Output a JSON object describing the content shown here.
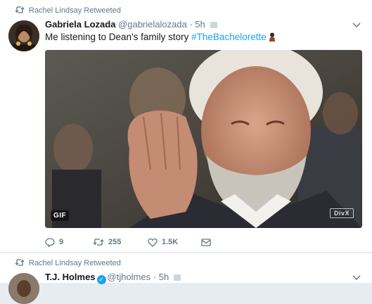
{
  "colors": {
    "accent": "#1da1f2",
    "secondary_text": "#657786",
    "primary_text": "#14171a",
    "background": "#e6ecf0"
  },
  "tweet1": {
    "retweet_label": "Rachel Lindsay Retweeted",
    "author_name": "Gabriela Lozada",
    "handle": "@gabrielalozada",
    "dot": "·",
    "time": "5h",
    "text_prefix": "Me listening to Dean's family story ",
    "hashtag": "#TheBachelorette",
    "media": {
      "gif_label": "GIF",
      "watermark": "DivX"
    },
    "actions": {
      "replies": "9",
      "retweets": "255",
      "likes": "1.5K"
    },
    "icons": [
      "retweet-icon",
      "chevron-down-icon",
      "reply-icon",
      "like-icon",
      "direct-message-icon"
    ]
  },
  "tweet2": {
    "retweet_label": "Rachel Lindsay Retweeted",
    "author_name": "T.J. Holmes",
    "handle": "@tjholmes",
    "dot": "·",
    "time": "5h"
  }
}
